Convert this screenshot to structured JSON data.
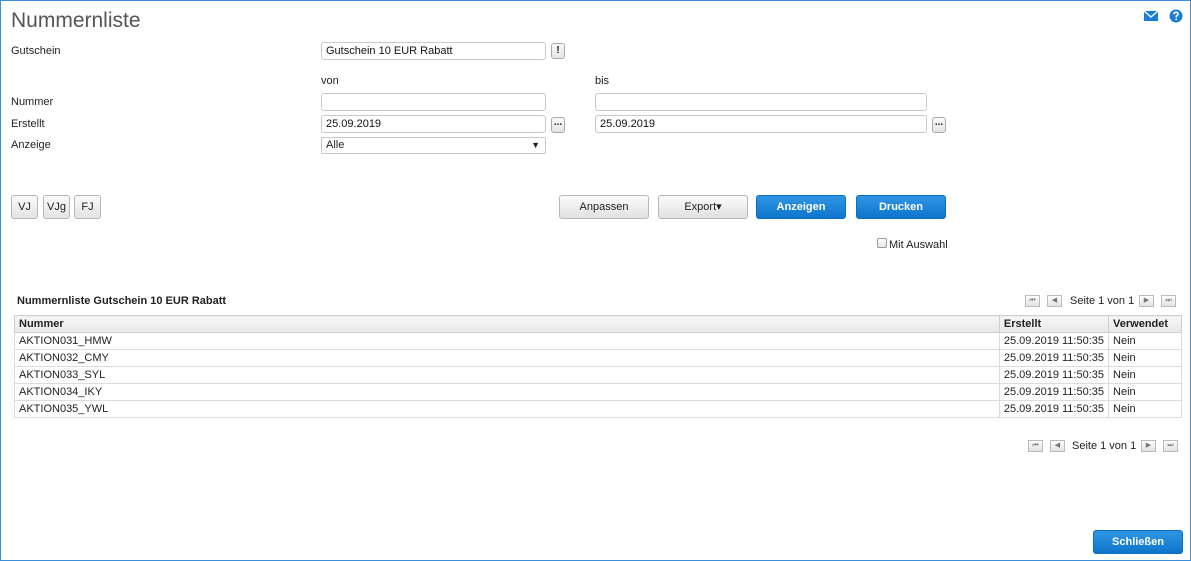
{
  "title": "Nummernliste",
  "header_icons": [
    "mail-icon",
    "help-icon"
  ],
  "form": {
    "gutschein_label": "Gutschein",
    "gutschein_value": "Gutschein 10 EUR Rabatt",
    "gutschein_btn": "!",
    "von_label": "von",
    "bis_label": "bis",
    "nummer_label": "Nummer",
    "nummer_von": "",
    "nummer_bis": "",
    "erstellt_label": "Erstellt",
    "erstellt_von": "25.09.2019",
    "erstellt_bis": "25.09.2019",
    "date_picker_btn": "...",
    "anzeige_label": "Anzeige",
    "anzeige_value": "Alle",
    "anzeige_arrow": "▼"
  },
  "period_buttons": [
    "VJ",
    "VJg",
    "FJ"
  ],
  "actions": {
    "anpassen": "Anpassen",
    "export": "Export▾",
    "anzeigen": "Anzeigen",
    "drucken": "Drucken",
    "mit_auswahl": "Mit Auswahl"
  },
  "list": {
    "title": "Nummernliste Gutschein 10 EUR Rabatt",
    "pager_text": "Seite 1 von 1",
    "pager_icons": {
      "first": "⏮",
      "prev": "◀",
      "next": "▶",
      "last": "⏭"
    },
    "columns": [
      "Nummer",
      "Erstellt",
      "Verwendet"
    ],
    "rows": [
      [
        "AKTION031_HMW",
        "25.09.2019 11:50:35",
        "Nein"
      ],
      [
        "AKTION032_CMY",
        "25.09.2019 11:50:35",
        "Nein"
      ],
      [
        "AKTION033_SYL",
        "25.09.2019 11:50:35",
        "Nein"
      ],
      [
        "AKTION034_IKY",
        "25.09.2019 11:50:35",
        "Nein"
      ],
      [
        "AKTION035_YWL",
        "25.09.2019 11:50:35",
        "Nein"
      ]
    ]
  },
  "close_button": "Schließen",
  "colors": {
    "accent": "#1a7fd4",
    "border": "#3a8fd8"
  }
}
